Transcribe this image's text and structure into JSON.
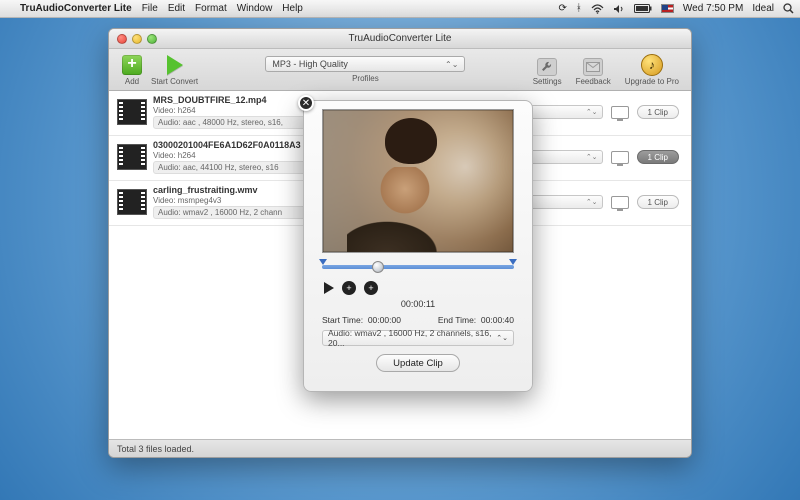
{
  "menubar": {
    "app_name": "TruAudioConverter Lite",
    "items": [
      "File",
      "Edit",
      "Format",
      "Window",
      "Help"
    ],
    "time": "Wed 7:50 PM",
    "user": "Ideal"
  },
  "window": {
    "title": "TruAudioConverter Lite"
  },
  "toolbar": {
    "add_label": "Add",
    "start_label": "Start Convert",
    "profile_selected": "MP3 - High Quality",
    "profiles_label": "Profiles",
    "settings_label": "Settings",
    "feedback_label": "Feedback",
    "upgrade_label": "Upgrade to Pro"
  },
  "files": [
    {
      "name": "MRS_DOUBTFIRE_12.mp4",
      "video": "Video: h264",
      "audio": "Audio: aac , 48000 Hz, stereo, s16,",
      "clip_label": "1 Clip",
      "active": false
    },
    {
      "name": "03000201004FE6A1D62F0A0118A3",
      "video": "Video: h264",
      "audio": "Audio: aac, 44100 Hz, stereo, s16",
      "clip_label": "1 Clip",
      "active": true
    },
    {
      "name": "carling_frustraiting.wmv",
      "video": "Video: msmpeg4v3",
      "audio": "Audio: wmav2 , 16000 Hz, 2 chann",
      "clip_label": "1 Clip",
      "active": false
    }
  ],
  "statusbar": {
    "text": "Total 3 files loaded."
  },
  "editor": {
    "current_time": "00:00:11",
    "start_label": "Start Time:",
    "start_value": "00:00:00",
    "end_label": "End Time:",
    "end_value": "00:00:40",
    "audio_select": "Audio: wmav2 , 16000 Hz, 2 channels, s16, 20...",
    "update_label": "Update Clip"
  }
}
